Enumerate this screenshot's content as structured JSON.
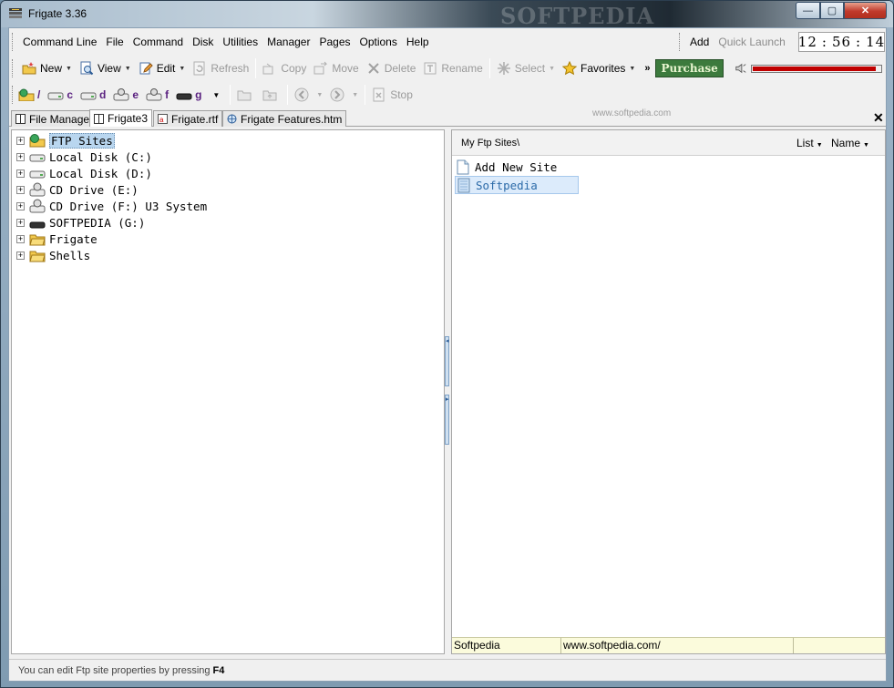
{
  "window": {
    "title": "Frigate 3.36",
    "watermark": "SOFTPEDIA",
    "minimize_glyph": "—",
    "maximize_glyph": "▢",
    "close_glyph": "✕"
  },
  "menu": {
    "items": [
      "Command Line",
      "File",
      "Command",
      "Disk",
      "Utilities",
      "Manager",
      "Pages",
      "Options",
      "Help"
    ],
    "add_label": "Add",
    "quick_launch_label": "Quick Launch"
  },
  "clock": {
    "hours": "12",
    "minutes": "56",
    "seconds": "14",
    "separator": ":"
  },
  "toolbar1": {
    "new": "New",
    "view": "View",
    "edit": "Edit",
    "refresh": "Refresh",
    "copy": "Copy",
    "move": "Move",
    "delete": "Delete",
    "rename": "Rename",
    "select": "Select",
    "favorites": "Favorites",
    "overflow": "»",
    "purchase": "Purchase",
    "volume_level": 0.97,
    "dropdown_glyph": "▼"
  },
  "toolbar2": {
    "drives": [
      "/",
      "c",
      "d",
      "e",
      "f",
      "g"
    ],
    "stop": "Stop",
    "softpedia_url": "www.softpedia.com"
  },
  "tabs": [
    "File Manager",
    "Frigate3",
    "Frigate.rtf",
    "Frigate Features.htm"
  ],
  "tab_close_glyph": "✕",
  "tree": {
    "expander": "+",
    "items": [
      "FTP Sites",
      "Local Disk (C:)",
      "Local Disk (D:)",
      "CD Drive (E:)",
      "CD Drive (F:) U3 System",
      "SOFTPEDIA (G:)",
      "Frigate",
      "Shells"
    ]
  },
  "splitter": {
    "left_arrow": "◂",
    "right_arrow": "▸"
  },
  "right_pane": {
    "path": "My Ftp Sites\\",
    "list_label": "List",
    "name_label": "Name",
    "items": [
      "Add New Site",
      "Softpedia"
    ],
    "status_name": "Softpedia",
    "status_url": "www.softpedia.com/"
  },
  "status": {
    "text": "You can edit Ftp site properties by pressing",
    "key": "F4"
  },
  "colors": {
    "accent": "#3c7a3d",
    "volume": "#c00000",
    "selection": "#b9d6ef"
  }
}
